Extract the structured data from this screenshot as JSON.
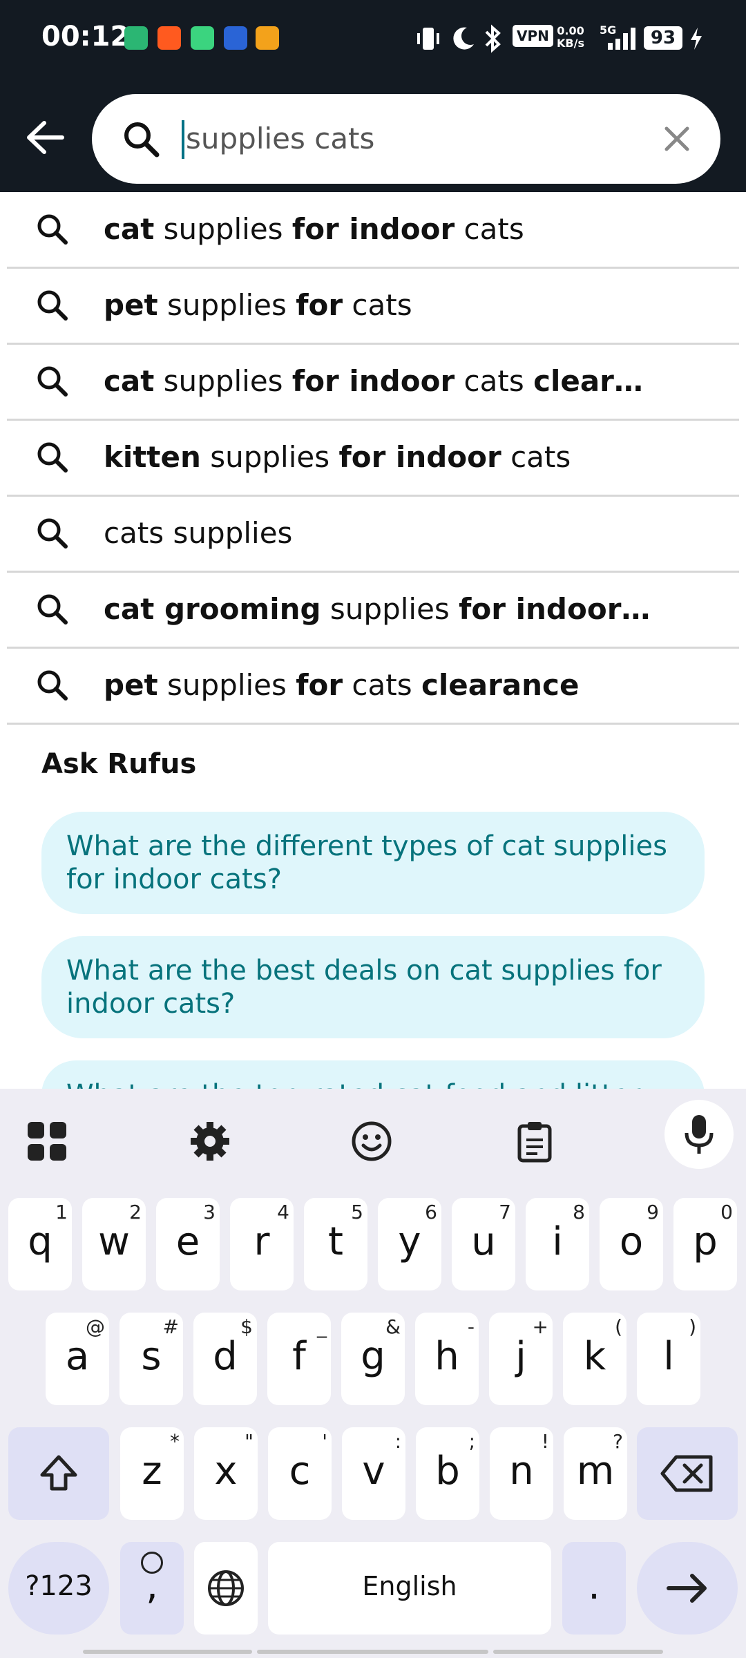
{
  "status": {
    "time": "00:12",
    "vpn": "VPN",
    "speed_top": "0.00",
    "speed_bottom": "KB/s",
    "net": "5G",
    "battery": "93"
  },
  "search": {
    "query": "supplies cats"
  },
  "suggestions": [
    [
      {
        "t": "cat",
        "b": true
      },
      {
        "t": " supplies ",
        "b": false
      },
      {
        "t": "for indoor",
        "b": true
      },
      {
        "t": " cats",
        "b": false
      }
    ],
    [
      {
        "t": "pet",
        "b": true
      },
      {
        "t": " supplies ",
        "b": false
      },
      {
        "t": "for",
        "b": true
      },
      {
        "t": " cats",
        "b": false
      }
    ],
    [
      {
        "t": "cat",
        "b": true
      },
      {
        "t": " supplies ",
        "b": false
      },
      {
        "t": "for indoor",
        "b": true
      },
      {
        "t": " cats ",
        "b": false
      },
      {
        "t": "clear…",
        "b": true
      }
    ],
    [
      {
        "t": "kitten",
        "b": true
      },
      {
        "t": " supplies ",
        "b": false
      },
      {
        "t": "for indoor",
        "b": true
      },
      {
        "t": " cats",
        "b": false
      }
    ],
    [
      {
        "t": "cats supplies",
        "b": false
      }
    ],
    [
      {
        "t": "cat grooming",
        "b": true
      },
      {
        "t": " supplies ",
        "b": false
      },
      {
        "t": "for indoor…",
        "b": true
      }
    ],
    [
      {
        "t": "pet",
        "b": true
      },
      {
        "t": " supplies ",
        "b": false
      },
      {
        "t": "for",
        "b": true
      },
      {
        "t": " cats ",
        "b": false
      },
      {
        "t": "clearance",
        "b": true
      }
    ]
  ],
  "rufus": {
    "title": "Ask Rufus",
    "questions": [
      "What are the different types of cat supplies for indoor cats?",
      "What are the best deals on cat supplies for indoor cats?",
      "What are the top-rated cat food and litter"
    ]
  },
  "keyboard": {
    "row1": [
      [
        "q",
        "1"
      ],
      [
        "w",
        "2"
      ],
      [
        "e",
        "3"
      ],
      [
        "r",
        "4"
      ],
      [
        "t",
        "5"
      ],
      [
        "y",
        "6"
      ],
      [
        "u",
        "7"
      ],
      [
        "i",
        "8"
      ],
      [
        "o",
        "9"
      ],
      [
        "p",
        "0"
      ]
    ],
    "row2": [
      [
        "a",
        "@"
      ],
      [
        "s",
        "#"
      ],
      [
        "d",
        "$"
      ],
      [
        "f",
        "_"
      ],
      [
        "g",
        "&"
      ],
      [
        "h",
        "-"
      ],
      [
        "j",
        "+"
      ],
      [
        "k",
        "("
      ],
      [
        "l",
        ")"
      ]
    ],
    "row3": [
      [
        "z",
        "*"
      ],
      [
        "x",
        "\""
      ],
      [
        "c",
        "'"
      ],
      [
        "v",
        ":"
      ],
      [
        "b",
        ";"
      ],
      [
        "n",
        "!"
      ],
      [
        "m",
        "?"
      ]
    ],
    "symbols_label": "?123",
    "space_label": "English",
    "period": ".",
    "comma": ","
  },
  "colors": {
    "header": "#131a22",
    "accent": "#007185",
    "chip_bg": "#dff6fb",
    "chip_text": "#07737c",
    "kb_bg": "#eeedf4",
    "kb_mod": "#dfe0f5"
  }
}
